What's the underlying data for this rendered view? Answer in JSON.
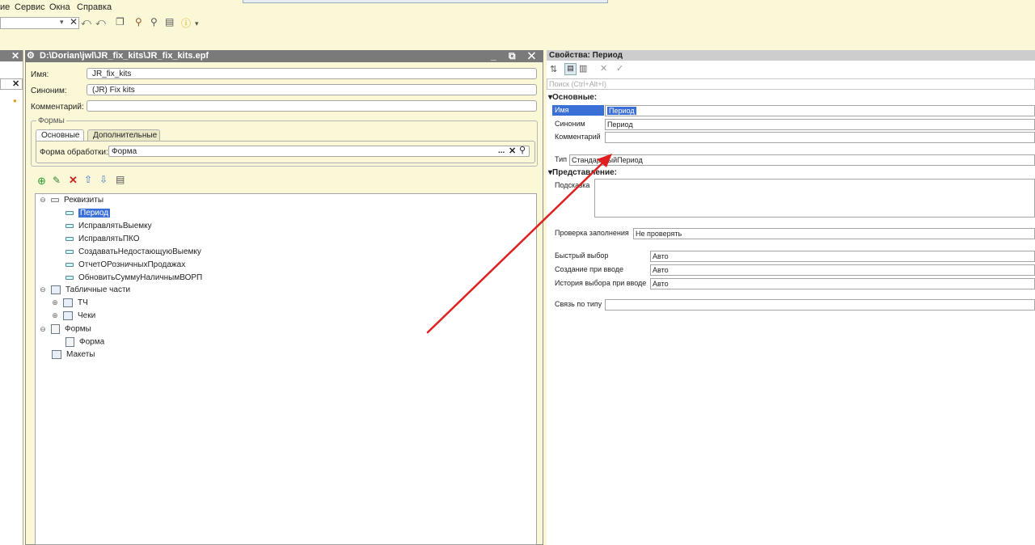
{
  "menu": {
    "items": [
      "ие",
      "Сервис",
      "Окна",
      "Справка"
    ]
  },
  "left_panel": {
    "close_icon": "×"
  },
  "document": {
    "title": "D:\\Dorian\\jwl\\JR_fix_kits\\JR_fix_kits.epf",
    "name_label": "Имя:",
    "name_value": "JR_fix_kits",
    "synonym_label": "Синоним:",
    "synonym_value": "(JR) Fix kits",
    "comment_label": "Комментарий:",
    "comment_value": "",
    "forms_group_label": "Формы",
    "tabs": [
      "Основные",
      "Дополнительные"
    ],
    "processing_form_label": "Форма обработки:",
    "processing_form_value": "Форма",
    "dots": "...",
    "tree": {
      "requisites": "Реквизиты",
      "requisite_items": [
        "Период",
        "ИсправлятьВыемку",
        "ИсправлятьПКО",
        "СоздаватьНедостающуюВыемку",
        "ОтчетОРозничныхПродажах",
        "ОбновитьСуммуНаличнымВОРП"
      ],
      "tabular_parts": "Табличные части",
      "tabular_items": [
        "ТЧ",
        "Чеки"
      ],
      "forms": "Формы",
      "form_items": [
        "Форма"
      ],
      "layouts": "Макеты"
    }
  },
  "properties": {
    "title": "Свойства: Период",
    "search_placeholder": "Поиск (Ctrl+Alt+I)",
    "section_main": "Основные:",
    "name_label": "Имя",
    "name_value": "Период",
    "synonym_label": "Синоним",
    "synonym_value": "Период",
    "comment_label": "Комментарий",
    "comment_value": "",
    "type_label": "Тип",
    "type_value": "СтандартныйПериод",
    "section_view": "Представление:",
    "hint_label": "Подсказка",
    "fill_check_label": "Проверка заполнения",
    "fill_check_value": "Не проверять",
    "quick_choice_label": "Быстрый выбор",
    "quick_choice_value": "Авто",
    "create_on_input_label": "Создание при вводе",
    "create_on_input_value": "Авто",
    "choice_history_label": "История выбора при вводе",
    "choice_history_value": "Авто",
    "link_by_type_label": "Связь по типу",
    "link_by_type_value": ""
  },
  "colors": {
    "background": "#fbf8d8",
    "selection": "#3b6fd8",
    "annotation_arrow": "#e02020"
  }
}
